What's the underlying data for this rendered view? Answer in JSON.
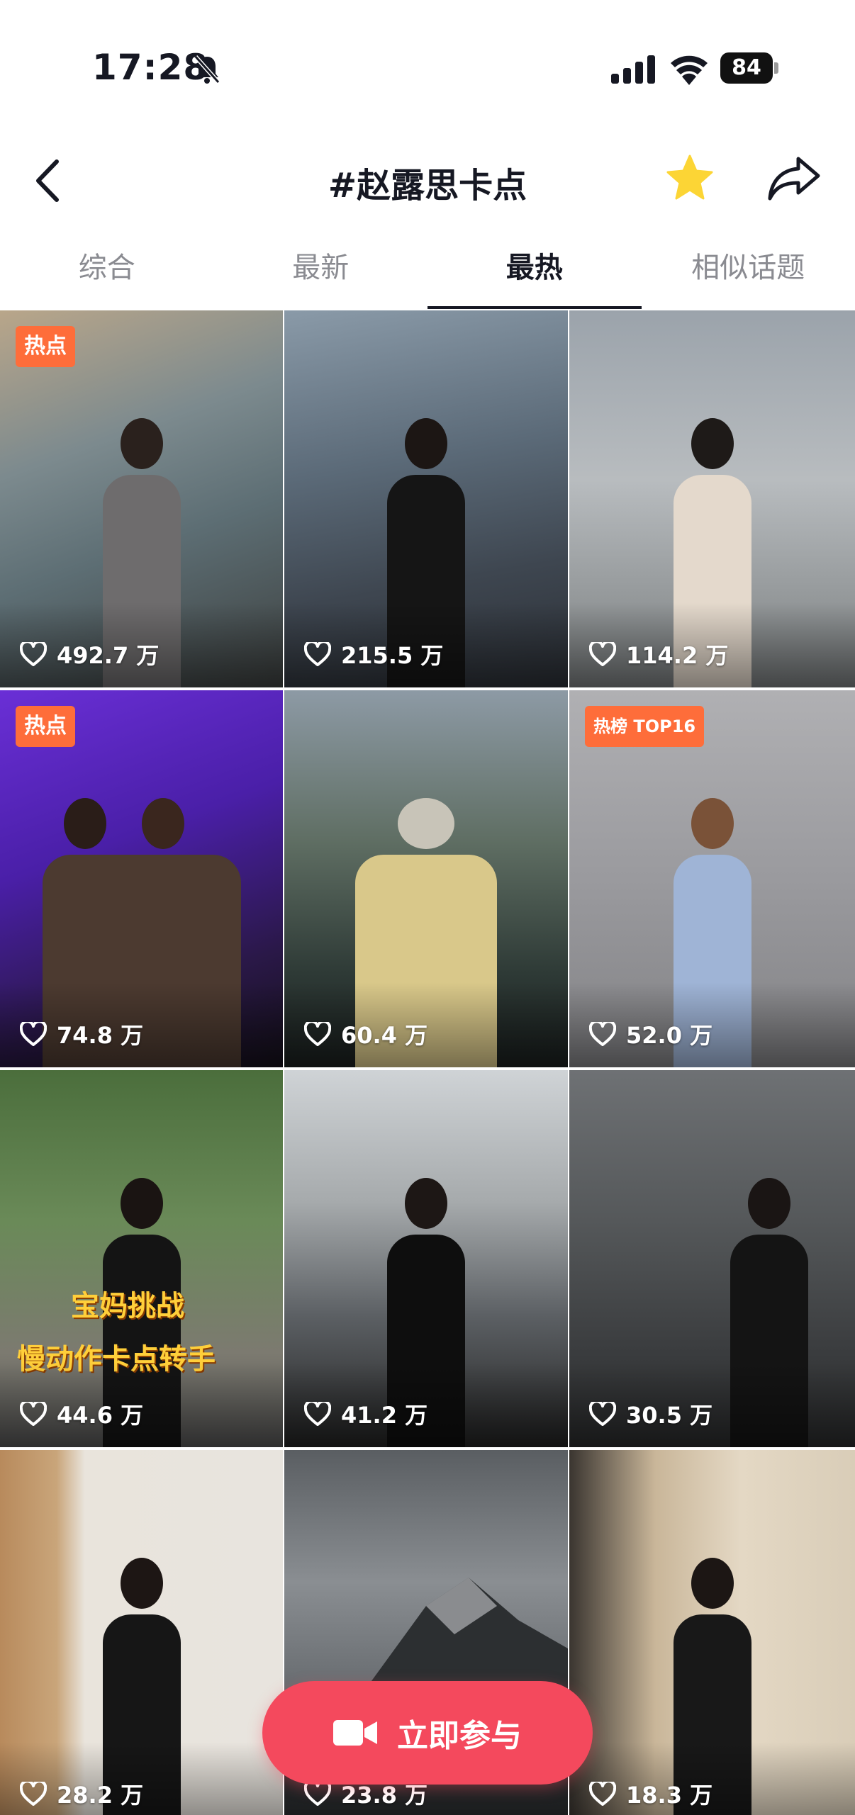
{
  "status_bar": {
    "time": "17:28",
    "battery": "84"
  },
  "header": {
    "title": "#赵露思卡点"
  },
  "tabs": [
    {
      "label": "综合"
    },
    {
      "label": "最新"
    },
    {
      "label": "最热"
    },
    {
      "label": "相似话题"
    }
  ],
  "active_tab": "最热",
  "videos": [
    {
      "likes": "492.7 万",
      "badge": "热点"
    },
    {
      "likes": "215.5 万"
    },
    {
      "likes": "114.2 万"
    },
    {
      "likes": "74.8 万",
      "badge": "热点"
    },
    {
      "likes": "60.4 万"
    },
    {
      "likes": "52.0 万",
      "badge": "热榜 TOP16"
    },
    {
      "likes": "44.6 万",
      "caption_line1": "宝妈挑战",
      "caption_line2": "慢动作卡点转手"
    },
    {
      "likes": "41.2 万"
    },
    {
      "likes": "30.5 万"
    },
    {
      "likes": "28.2 万"
    },
    {
      "likes": "23.8 万"
    },
    {
      "likes": "18.3 万"
    }
  ],
  "join_button": {
    "label": "立即参与"
  },
  "colors": {
    "accent": "#f4495d",
    "badge": "#fe6d3a",
    "star": "#fcd535"
  },
  "icons": [
    "bell-off-icon",
    "signal-icon",
    "wifi-icon",
    "battery-icon",
    "back-icon",
    "star-icon",
    "share-icon",
    "heart-icon",
    "camera-icon"
  ]
}
